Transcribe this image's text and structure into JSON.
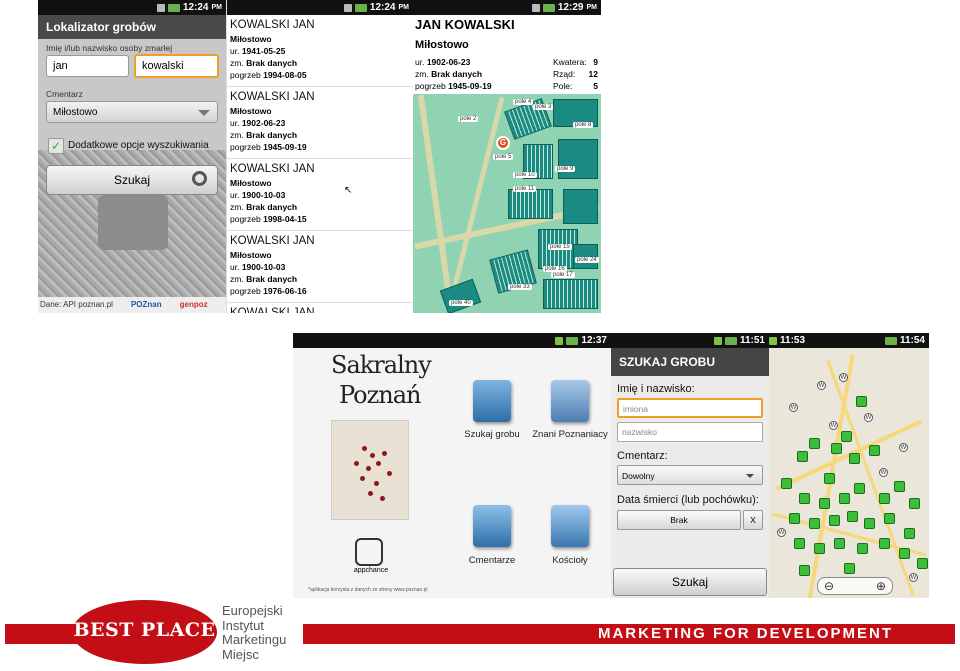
{
  "screen1": {
    "time": "12:24",
    "time_suffix": "PM",
    "title": "Lokalizator grobów",
    "name_label": "Imię i/lub nazwisko osoby zmarłej",
    "first_name": "jan",
    "last_name": "kowalski",
    "cemetery_label": "Cmentarz",
    "cemetery_value": "Miłostowo",
    "extra_options_label": "Dodatkowe opcje wyszukiwania",
    "search_label": "Szukaj",
    "footer_source": "Dane: API poznan.pl",
    "footer_logo1": "POZnan",
    "footer_logo2": "genpoz"
  },
  "screen2": {
    "time": "12:24",
    "time_suffix": "PM",
    "results": [
      {
        "name": "KOWALSKI JAN",
        "cemetery": "Miłostowo",
        "born_label": "ur.",
        "born": "1941-05-25",
        "died_label": "zm.",
        "died": "Brak danych",
        "burial_label": "pogrzeb",
        "burial": "1994-08-05"
      },
      {
        "name": "KOWALSKI JAN",
        "cemetery": "Miłostowo",
        "born_label": "ur.",
        "born": "1902-06-23",
        "died_label": "zm.",
        "died": "Brak danych",
        "burial_label": "pogrzeb",
        "burial": "1945-09-19"
      },
      {
        "name": "KOWALSKI JAN",
        "cemetery": "Miłostowo",
        "born_label": "ur.",
        "born": "1900-10-03",
        "died_label": "zm.",
        "died": "Brak danych",
        "burial_label": "pogrzeb",
        "burial": "1998-04-15"
      },
      {
        "name": "KOWALSKI JAN",
        "cemetery": "Miłostowo",
        "born_label": "ur.",
        "born": "1900-10-03",
        "died_label": "zm.",
        "died": "Brak danych",
        "burial_label": "pogrzeb",
        "burial": "1976-06-16"
      },
      {
        "name": "KOWALSKI JAN"
      }
    ]
  },
  "screen3": {
    "time": "12:29",
    "time_suffix": "PM",
    "name": "JAN KOWALSKI",
    "cemetery": "Miłostowo",
    "born_label": "ur.",
    "born": "1902-06-23",
    "died_label": "zm.",
    "died": "Brak danych",
    "burial_label": "pogrzeb",
    "burial": "1945-09-19",
    "kwatera_label": "Kwatera:",
    "kwatera": "9",
    "rzad_label": "Rząd:",
    "rzad": "12",
    "pole_label": "Pole:",
    "pole": "5",
    "pin_label": "G",
    "field_labels": [
      "pole 4",
      "pole 2",
      "pole 5",
      "pole 10",
      "pole 9",
      "pole 11",
      "pole 15",
      "pole 16",
      "pole 17",
      "pole 24",
      "pole 3",
      "pole 8",
      "pole 33",
      "pole 40"
    ]
  },
  "screen4": {
    "time": "12:37",
    "title_line1": "Sakralny",
    "title_line2": "Poznań",
    "tiles": [
      "Szukaj grobu",
      "Znani Poznaniacy",
      "Cmentarze",
      "Kościoły"
    ],
    "appchance": "appchance",
    "footer_note": "*aplikacja korzysta z danych ze strony www.poznan.pl"
  },
  "screen5": {
    "time": "11:51",
    "title": "SZUKAJ GROBU",
    "name_label": "Imię i nazwisko:",
    "first_placeholder": "imiona",
    "last_placeholder": "nazwisko",
    "cemetery_label": "Cmentarz:",
    "cemetery_value": "Dowolny",
    "death_label": "Data śmierci (lub pochówku):",
    "death_value": "Brak",
    "clear_label": "X",
    "search_label": "Szukaj"
  },
  "screen6": {
    "time_left": "11:53",
    "time_right": "11:54",
    "zoom_out": "⊖",
    "zoom_in": "⊕"
  },
  "branding": {
    "logo_text": "BEST PLACE",
    "institute": [
      "Europejski",
      "Instytut",
      "Marketingu",
      "Miejsc"
    ],
    "slogan": "MARKETING FOR DEVELOPMENT"
  },
  "colors": {
    "brand_red": "#c40e16",
    "map_green": "#8fd3b2",
    "plot_teal": "#1a8a82",
    "focus_orange": "#f0a020"
  }
}
